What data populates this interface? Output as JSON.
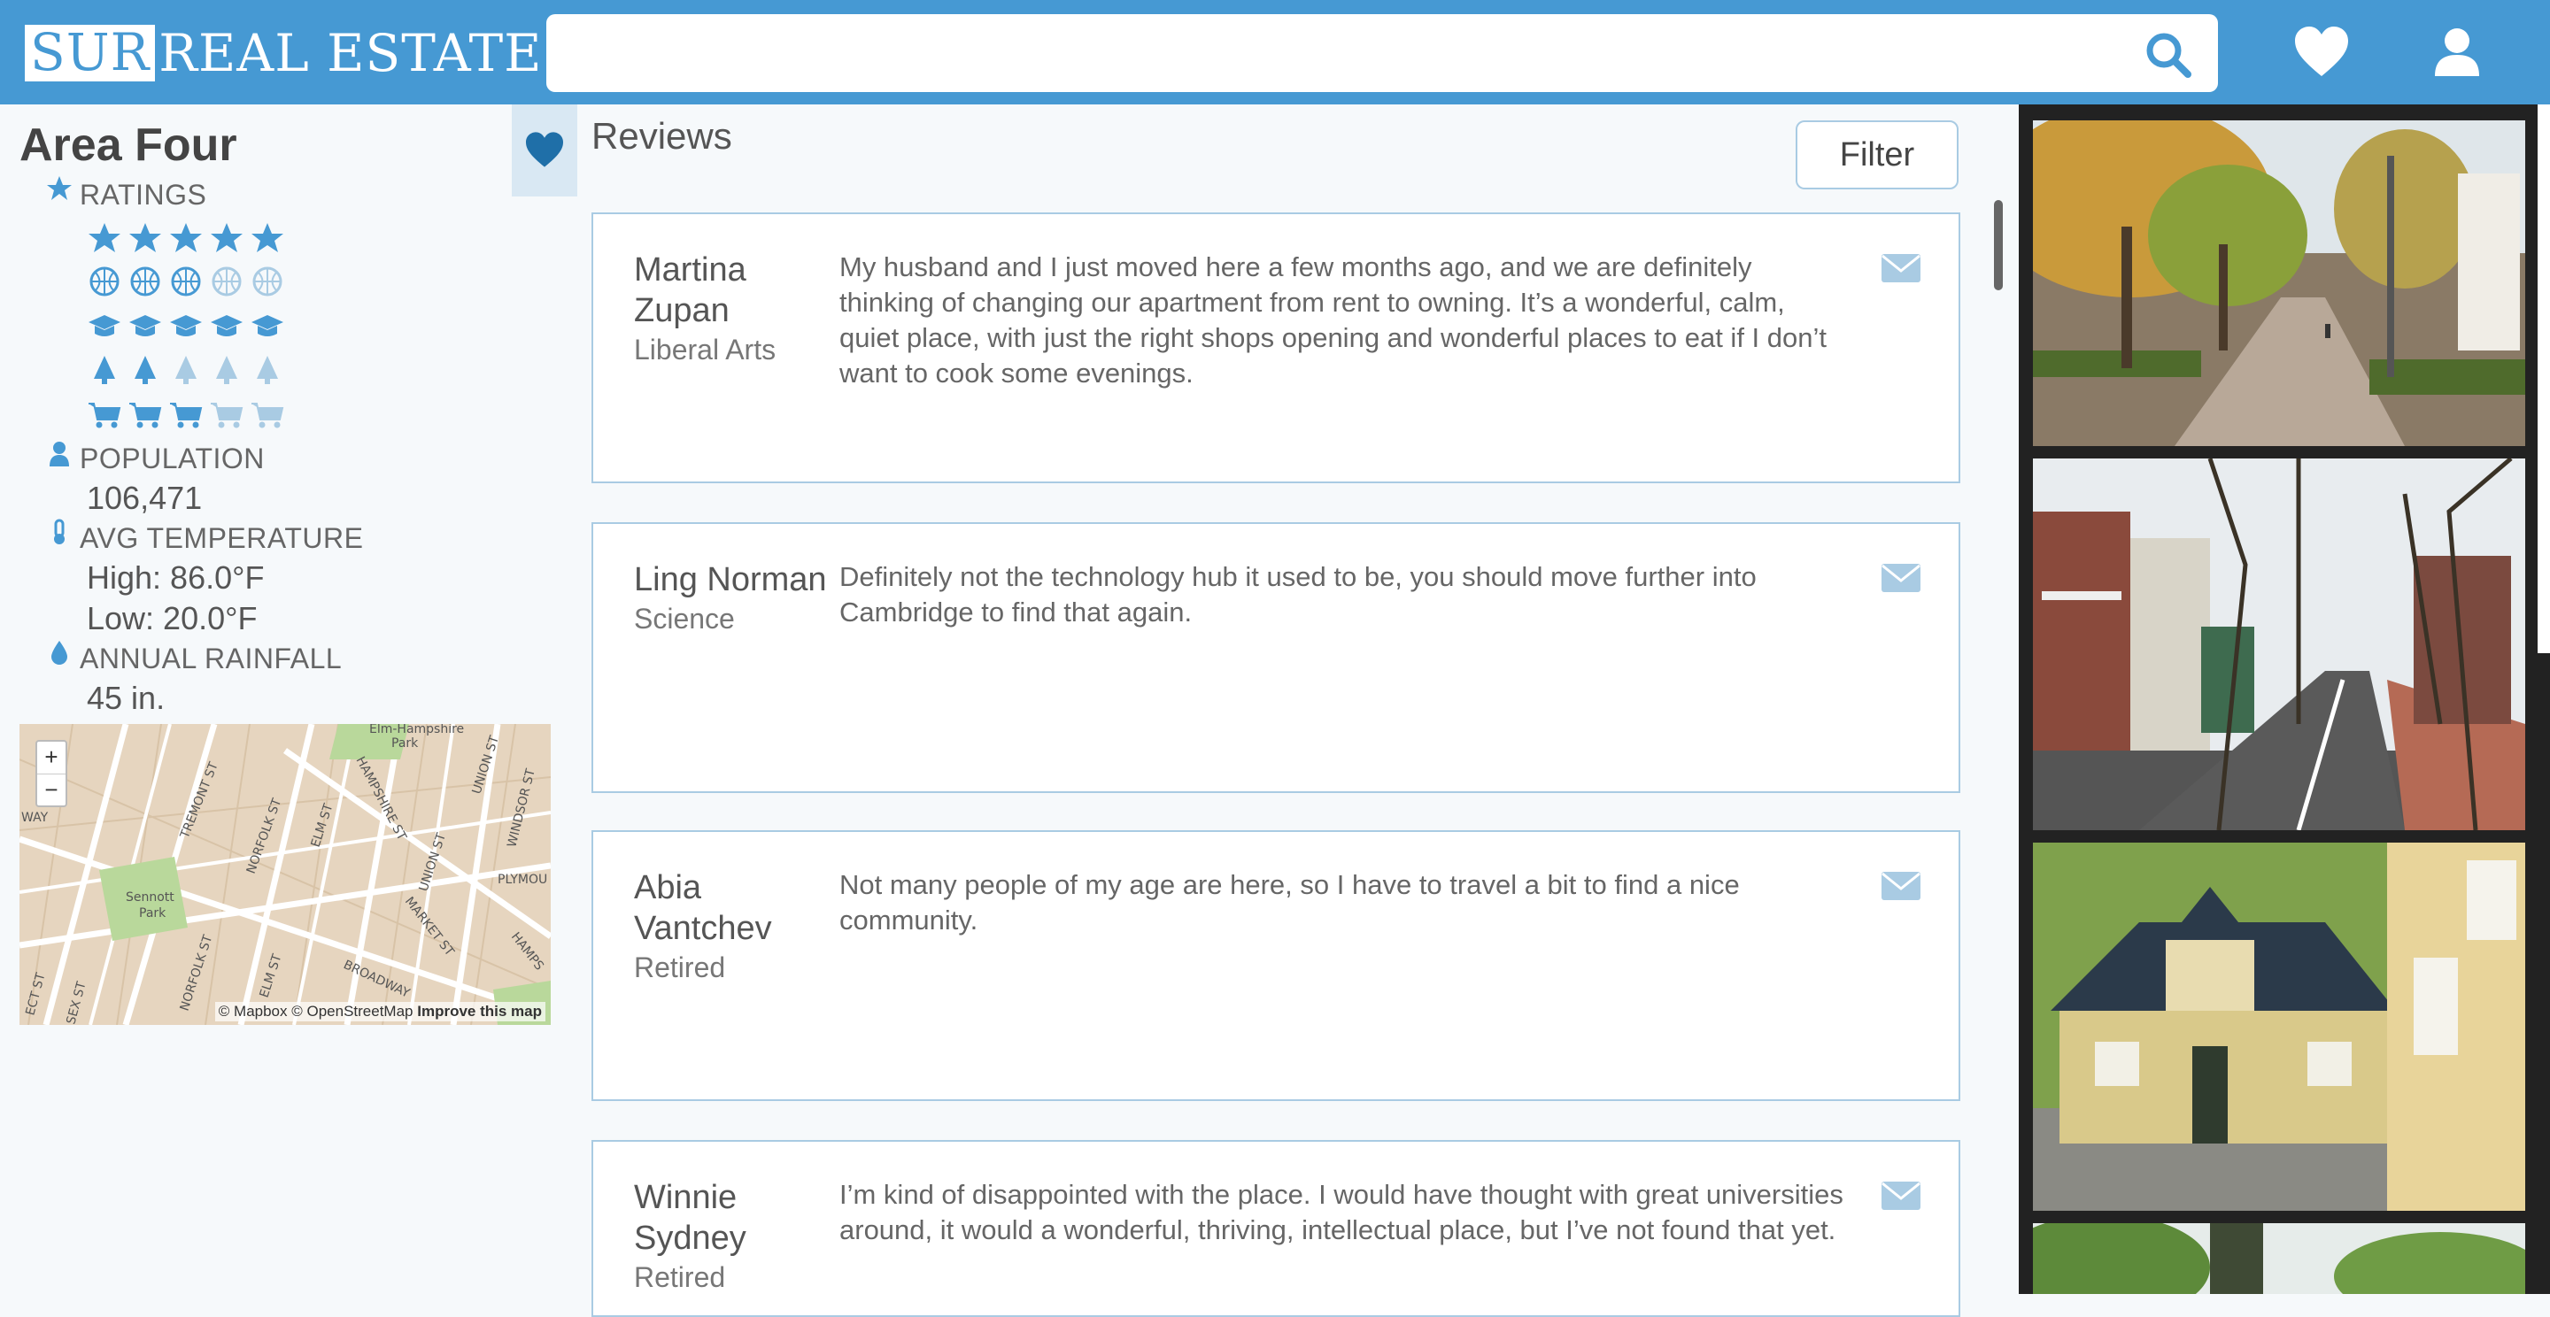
{
  "header": {
    "logo_boxed": "SUR",
    "logo_rest": "REAL ESTATE",
    "search_value": "",
    "search_placeholder": "",
    "icons": [
      "search-icon",
      "heart-icon",
      "user-icon"
    ],
    "colors": {
      "brand": "#4699d3",
      "white": "#ffffff"
    }
  },
  "area": {
    "title": "Area Four",
    "ratings_label": "RATINGS",
    "ratings": [
      {
        "category": "star",
        "icon": "star-icon",
        "score": 5,
        "max": 5
      },
      {
        "category": "sports",
        "icon": "basketball-icon",
        "score": 3,
        "max": 5
      },
      {
        "category": "education",
        "icon": "graduation-cap-icon",
        "score": 5,
        "max": 5
      },
      {
        "category": "nature",
        "icon": "tree-icon",
        "score": 2,
        "max": 5
      },
      {
        "category": "shopping",
        "icon": "cart-icon",
        "score": 3,
        "max": 5
      }
    ],
    "population_label": "POPULATION",
    "population_value": "106,471",
    "temperature_label": "AVG TEMPERATURE",
    "temperature_high": "High: 86.0°F",
    "temperature_low": "Low: 20.0°F",
    "rainfall_label": "ANNUAL RAINFALL",
    "rainfall_value": "45 in."
  },
  "map": {
    "zoom_in": "+",
    "zoom_out": "−",
    "street_labels": [
      "Elm-Hampshire Park",
      "TREMONT ST",
      "NORFOLK ST",
      "ELM ST",
      "HAMPSHIRE ST",
      "UNION ST",
      "WINDSOR ST",
      "Sennott Park",
      "MARKET ST",
      "BROADWAY",
      "PLYMOU",
      "HAMPS",
      "WAY",
      "ECT ST",
      "SEX ST"
    ],
    "attribution_a": "© Mapbox © OpenStreetMap",
    "attribution_b": "Improve this map"
  },
  "reviews": {
    "title": "Reviews",
    "filter_label": "Filter",
    "items": [
      {
        "name": "Martina Zupan",
        "role": "Liberal Arts",
        "text": "My husband and I just moved here a few months ago, and we are definitely thinking of changing our apartment from rent to owning. It’s a wonderful, calm, quiet place, with just the right shops opening and wonderful places to eat if I don’t want to cook some evenings."
      },
      {
        "name": "Ling Norman",
        "role": "Science",
        "text": "Definitely not the technology hub it used to be, you should move further into Cambridge to find that again."
      },
      {
        "name": "Abia Vantchev",
        "role": "Retired",
        "text": "Not many people of my age are here, so I have to travel a bit to find a nice community."
      },
      {
        "name": "Winnie Sydney",
        "role": "Retired",
        "text": "I’m kind of disappointed with the place. I would have thought with great universities around, it would a wonderful, thriving, intellectual place, but I’ve not found that yet."
      }
    ]
  },
  "photos": [
    "autumn-park-path",
    "residential-street",
    "yellow-house",
    "green-trees"
  ]
}
